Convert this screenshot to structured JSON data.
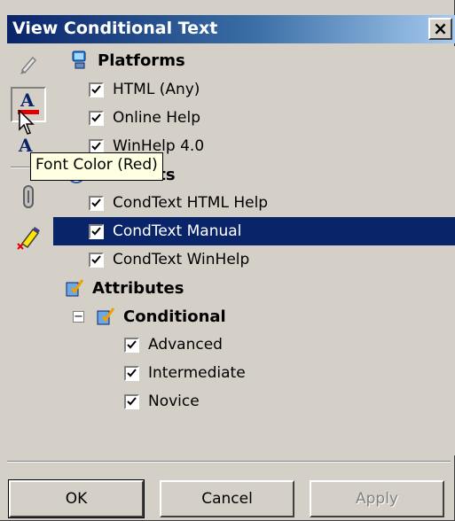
{
  "window": {
    "title": "View Conditional Text",
    "close_glyph": "×"
  },
  "toolbar": {
    "items": [
      {
        "name": "pencil-icon"
      },
      {
        "name": "font-color-icon",
        "glyph": "A",
        "pressed": true
      },
      {
        "name": "font-style-icon",
        "glyph": "A"
      },
      {
        "name": "paperclip-icon"
      },
      {
        "name": "highlighter-icon"
      }
    ]
  },
  "tooltip": {
    "text": "Font Color (Red)"
  },
  "groups": {
    "platforms": {
      "label": "Platforms",
      "items": [
        {
          "label": "HTML (Any)",
          "checked": true
        },
        {
          "label": "Online Help",
          "checked": true
        },
        {
          "label": "WinHelp 4.0",
          "checked": true
        }
      ]
    },
    "targets": {
      "label_visible": "ets",
      "items": [
        {
          "label": "CondText HTML Help",
          "checked": true
        },
        {
          "label": "CondText Manual",
          "checked": true,
          "selected": true
        },
        {
          "label": "CondText WinHelp",
          "checked": true
        }
      ]
    },
    "attributes": {
      "label": "Attributes",
      "conditional": {
        "expander": "−",
        "label": "Conditional",
        "items": [
          {
            "label": "Advanced",
            "checked": true
          },
          {
            "label": "Intermediate",
            "checked": true
          },
          {
            "label": "Novice",
            "checked": true
          }
        ]
      }
    }
  },
  "buttons": {
    "ok": "OK",
    "cancel": "Cancel",
    "apply": "Apply"
  },
  "colors": {
    "selection": "#0a246a",
    "font_color_red": "#e00000",
    "tooltip_bg": "#ffffe1"
  }
}
